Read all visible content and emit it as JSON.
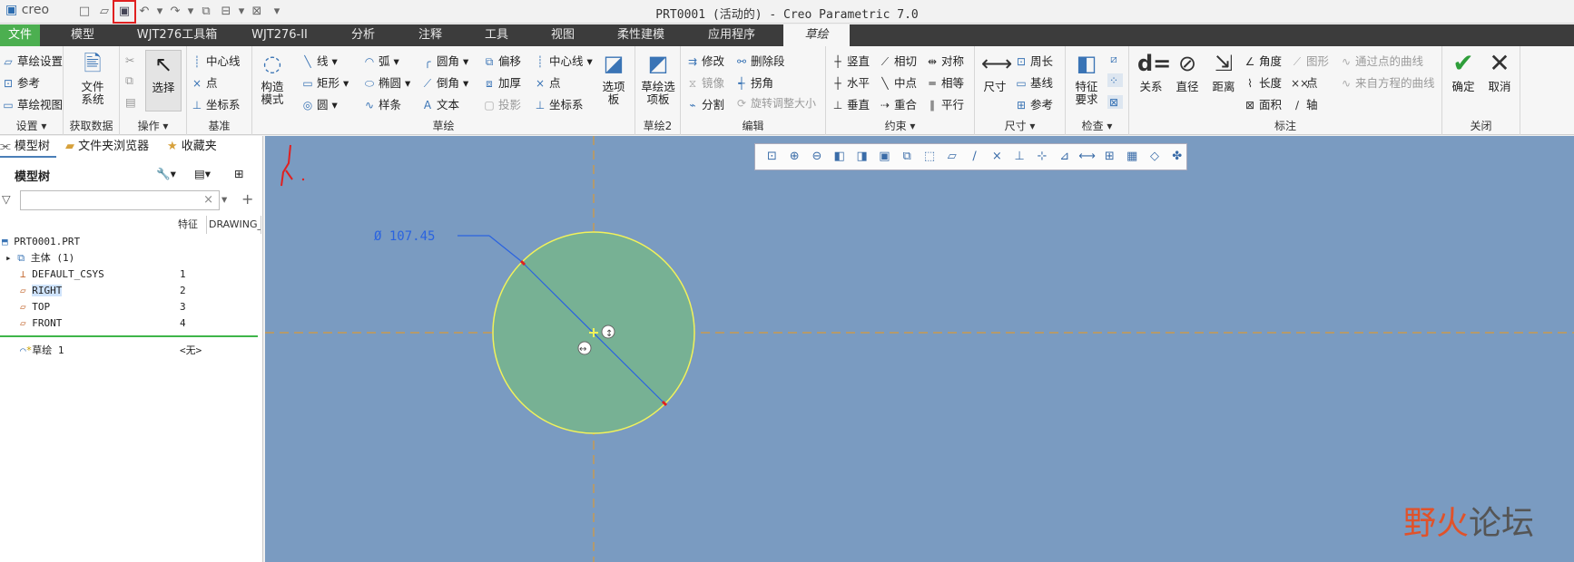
{
  "app": {
    "logo": "creo",
    "title": "PRT0001 (活动的) - Creo Parametric 7.0"
  },
  "qat_icons": [
    "new-icon",
    "open-icon",
    "save-icon",
    "undo-icon",
    "redo-icon",
    "regenerate-icon",
    "windows-icon",
    "close-icon",
    "customize-icon"
  ],
  "tabs": [
    "文件",
    "模型",
    "WJT276工具箱",
    "WJT276-II",
    "分析",
    "注释",
    "工具",
    "视图",
    "柔性建模",
    "应用程序",
    "草绘"
  ],
  "groups": {
    "setup": {
      "items": [
        "草绘设置",
        "参考",
        "草绘视图"
      ],
      "label": "设置"
    },
    "getdata": {
      "big": "文件\n系统",
      "label": "获取数据"
    },
    "ops": {
      "big": "选择",
      "label": "操作"
    },
    "datum": {
      "items": [
        "中心线",
        "点",
        "坐标系"
      ],
      "label": "基准"
    },
    "sketch": {
      "big": "构造\n模式",
      "c1": [
        "线",
        "矩形",
        "圆"
      ],
      "c2": [
        "弧",
        "椭圆",
        "样条"
      ],
      "c3": [
        "圆角",
        "倒角",
        "文本"
      ],
      "c4": [
        "偏移",
        "加厚",
        "投影"
      ],
      "c5": [
        "中心线",
        "点",
        "坐标系"
      ],
      "big2": "选项\n板",
      "label": "草绘"
    },
    "sketch2": {
      "big": "草绘选\n项板",
      "label": "草绘2"
    },
    "edit": {
      "c1": [
        "修改",
        "镜像",
        "分割"
      ],
      "c2": [
        "删除段",
        "拐角",
        "旋转调整大小"
      ],
      "label": "编辑"
    },
    "constraint": {
      "c1": [
        "竖直",
        "水平",
        "垂直"
      ],
      "c2": [
        "相切",
        "中点",
        "重合"
      ],
      "c3": [
        "对称",
        "相等",
        "平行"
      ],
      "label": "约束"
    },
    "dim": {
      "big": "尺寸",
      "items": [
        "周长",
        "基线",
        "参考"
      ],
      "label": "尺寸"
    },
    "inspect": {
      "big": "特征\n要求",
      "label": "检查"
    },
    "annot": {
      "big": [
        "关系",
        "直径",
        "距离"
      ],
      "c1": [
        "角度",
        "长度",
        "面积"
      ],
      "c2": [
        "图形",
        "点",
        "轴"
      ],
      "c3": [
        "通过点的曲线",
        "来自方程的曲线"
      ],
      "label": "标注"
    },
    "close": {
      "ok": "确定",
      "cancel": "取消",
      "label": "关闭"
    }
  },
  "leftpanel": {
    "tabs": [
      "模型树",
      "文件夹浏览器",
      "收藏夹"
    ],
    "title": "模型树",
    "col_headers": [
      "特征",
      "DRAWING_N"
    ],
    "rows": [
      {
        "name": "PRT0001.PRT",
        "id": ""
      },
      {
        "name": "主体 (1)",
        "id": ""
      },
      {
        "name": "DEFAULT_CSYS",
        "id": "1"
      },
      {
        "name": "RIGHT",
        "id": "2"
      },
      {
        "name": "TOP",
        "id": "3"
      },
      {
        "name": "FRONT",
        "id": "4"
      },
      {
        "name": "草绘 1",
        "id": "<无>"
      }
    ]
  },
  "canvas": {
    "dimension": "Ø 107.45"
  },
  "viewtool_icons": [
    "refit-icon",
    "zoom-in-icon",
    "zoom-out-icon",
    "repaint-icon",
    "display-style-icon",
    "saved-views-icon",
    "view-manager-icon",
    "sketch-view-icon",
    "plane-display-icon",
    "axis-display-icon",
    "point-display-icon",
    "csys-display-icon",
    "annotation-display-icon",
    "sketcher-display-icon",
    "dimension-display-icon",
    "constraint-display-icon",
    "grid-display-icon",
    "vertex-display-icon",
    "spin-center-icon"
  ],
  "watermark": {
    "a": "野火",
    "b": "论坛"
  }
}
